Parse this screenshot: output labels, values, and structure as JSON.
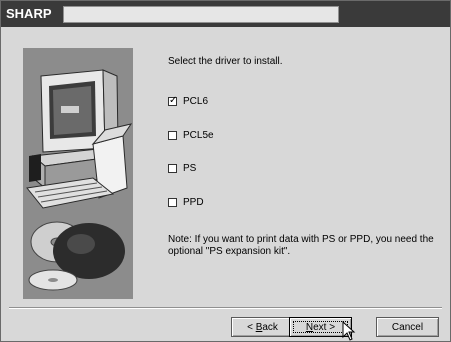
{
  "window": {
    "title": "SHARP"
  },
  "main": {
    "instruction": "Select the driver to install.",
    "options": [
      {
        "label": "PCL6",
        "checked": true
      },
      {
        "label": "PCL5e",
        "checked": false
      },
      {
        "label": "PS",
        "checked": false
      },
      {
        "label": "PPD",
        "checked": false
      }
    ],
    "note": "Note: If you want to print data with PS or PPD, you need the optional \"PS expansion kit\"."
  },
  "buttons": {
    "back_prefix": "< ",
    "back_mnemonic": "B",
    "back_rest": "ack",
    "next_mnemonic": "N",
    "next_rest": "ext >",
    "cancel": "Cancel"
  },
  "icons": [
    "computer-illustration",
    "cd-disc-illustration",
    "checkmark-icon",
    "mouse-cursor-icon"
  ]
}
